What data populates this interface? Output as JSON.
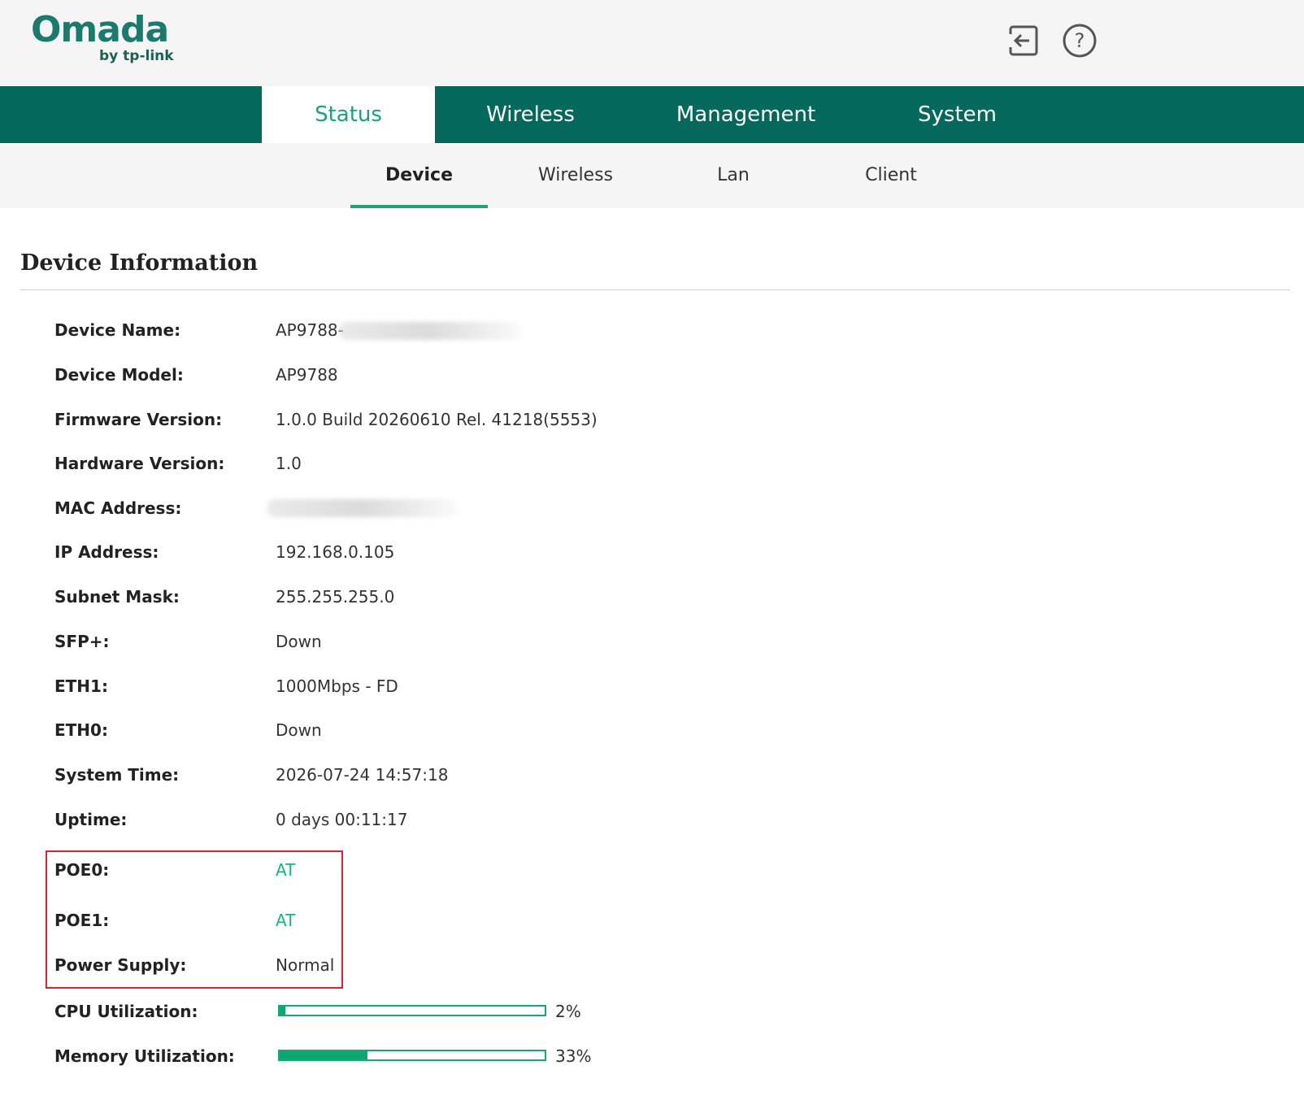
{
  "header": {
    "logo": "Omada",
    "logo_sub": "by tp-link",
    "icons": [
      "logout-icon",
      "help-icon"
    ]
  },
  "main_nav": {
    "tabs": [
      {
        "label": "Status",
        "active": true
      },
      {
        "label": "Wireless",
        "active": false
      },
      {
        "label": "Management",
        "active": false
      },
      {
        "label": "System",
        "active": false
      }
    ]
  },
  "sub_nav": {
    "tabs": [
      {
        "label": "Device",
        "active": true
      },
      {
        "label": "Wireless",
        "active": false
      },
      {
        "label": "Lan",
        "active": false
      },
      {
        "label": "Client",
        "active": false
      }
    ]
  },
  "section": {
    "title": "Device Information"
  },
  "info": {
    "device_name_label": "Device Name:",
    "device_name_value": "AP9788-",
    "device_model_label": "Device Model:",
    "device_model_value": "AP9788",
    "firmware_label": "Firmware Version:",
    "firmware_value": "1.0.0 Build 20260610 Rel. 41218(5553)",
    "hardware_label": "Hardware Version:",
    "hardware_value": "1.0",
    "mac_label": "MAC Address:",
    "mac_value": "",
    "ip_label": "IP Address:",
    "ip_value": "192.168.0.105",
    "subnet_label": "Subnet Mask:",
    "subnet_value": "255.255.255.0",
    "sfp_label": "SFP+:",
    "sfp_value": "Down",
    "eth1_label": "ETH1:",
    "eth1_value": "1000Mbps - FD",
    "eth0_label": "ETH0:",
    "eth0_value": "Down",
    "systime_label": "System Time:",
    "systime_value": "2026-07-24 14:57:18",
    "uptime_label": "Uptime:",
    "uptime_value": "0 days 00:11:17",
    "poe0_label": "POE0:",
    "poe0_value": "AT",
    "poe1_label": "POE1:",
    "poe1_value": "AT",
    "power_label": "Power Supply:",
    "power_value": "Normal",
    "cpu_label": "CPU Utilization:",
    "cpu_text": "2%",
    "cpu_percent": 2,
    "mem_label": "Memory Utilization:",
    "mem_text": "33%",
    "mem_percent": 33
  },
  "colors": {
    "nav_bg": "#04685c",
    "accent_green": "#1aa37a",
    "highlight_red": "#e0202d"
  }
}
